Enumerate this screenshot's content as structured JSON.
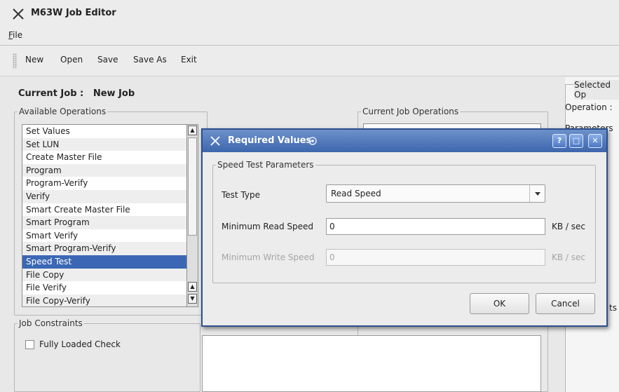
{
  "window": {
    "title": "M63W Job Editor"
  },
  "menu": {
    "file": "File"
  },
  "toolbar": {
    "items": [
      "New",
      "Open",
      "Save",
      "Save As",
      "Exit"
    ]
  },
  "current_job": {
    "label": "Current Job :",
    "value": "New Job"
  },
  "available_operations": {
    "legend": "Available Operations",
    "items": [
      "Set Values",
      "Set LUN",
      "Create Master File",
      "Program",
      "Program-Verify",
      "Verify",
      "Smart Create Master File",
      "Smart Program",
      "Smart Verify",
      "Smart Program-Verify",
      "Speed Test",
      "File Copy",
      "File Verify",
      "File Copy-Verify"
    ],
    "selected": "Speed Test"
  },
  "current_job_operations": {
    "legend": "Current Job Operations"
  },
  "job_constraints": {
    "legend": "Job Constraints",
    "fully_loaded_label": "Fully Loaded Check"
  },
  "selected_operation": {
    "legend": "Selected Op",
    "operation_label": "Operation :",
    "parameters_label": "Parameters",
    "partial_btn": "ts"
  },
  "dialog": {
    "title": "Required Values",
    "group_legend": "Speed Test Parameters",
    "test_type_label": "Test Type",
    "test_type_value": "Read Speed",
    "min_read_label": "Minimum Read Speed",
    "min_read_value": "0",
    "min_read_unit": "KB / sec",
    "min_write_label": "Minimum Write Speed",
    "min_write_value": "0",
    "min_write_unit": "KB / sec",
    "ok": "OK",
    "cancel": "Cancel",
    "help_btn": "?",
    "max_btn": "□",
    "close_btn": "✕"
  }
}
